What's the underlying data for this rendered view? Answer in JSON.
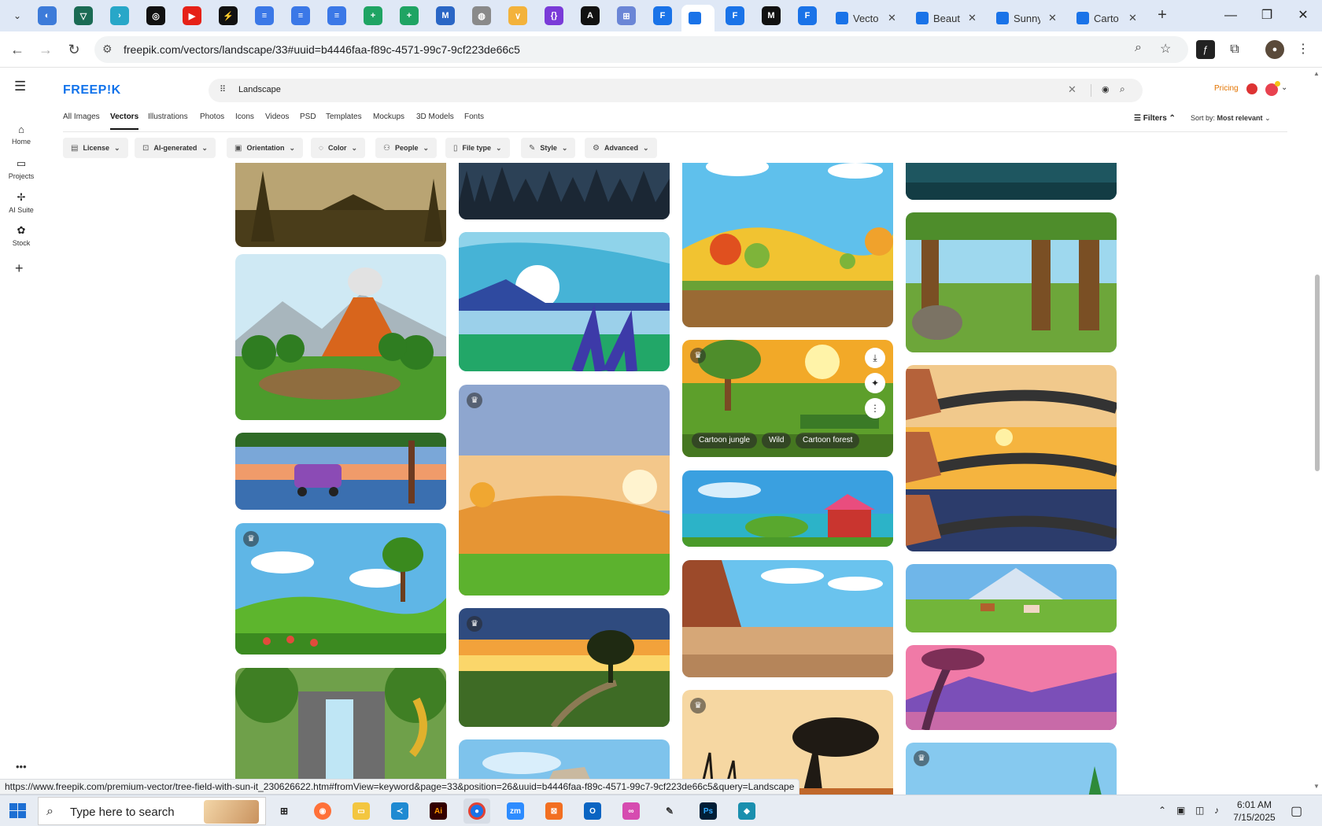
{
  "browser": {
    "tabs": [
      {
        "title": "Vecto"
      },
      {
        "title": "Beaut"
      },
      {
        "title": "Sunny"
      },
      {
        "title": "Carto"
      }
    ],
    "url": "freepik.com/vectors/landscape/33#uuid=b4446faa-f89c-4571-99c7-9cf223de66c5",
    "status_url": "https://www.freepik.com/premium-vector/tree-field-with-sun-it_230626622.htm#fromView=keyword&page=33&position=26&uuid=b4446faa-f89c-4571-99c7-9cf223de66c5&query=Landscape"
  },
  "sidebar": {
    "items": [
      {
        "label": "Home",
        "icon": "home-icon"
      },
      {
        "label": "Projects",
        "icon": "folder-icon"
      },
      {
        "label": "AI Suite",
        "icon": "sparkle-icon"
      },
      {
        "label": "Stock",
        "icon": "stock-icon"
      }
    ]
  },
  "header": {
    "logo": "FREEP!K",
    "search_value": "Landscape",
    "pricing": "Pricing"
  },
  "type_tabs": [
    {
      "label": "All Images",
      "active": false
    },
    {
      "label": "Vectors",
      "active": true
    },
    {
      "label": "Illustrations",
      "active": false
    },
    {
      "label": "Photos",
      "active": false
    },
    {
      "label": "Icons",
      "active": false
    },
    {
      "label": "Videos",
      "active": false
    },
    {
      "label": "PSD",
      "active": false
    },
    {
      "label": "Templates",
      "active": false
    },
    {
      "label": "Mockups",
      "active": false
    },
    {
      "label": "3D Models",
      "active": false
    },
    {
      "label": "Fonts",
      "active": false
    }
  ],
  "filters": {
    "toggle_label": "Filters",
    "sort_label": "Sort by:",
    "sort_value": "Most relevant",
    "chips": [
      {
        "label": "License",
        "icon": "license-icon"
      },
      {
        "label": "AI-generated",
        "icon": "ai-icon"
      },
      {
        "label": "Orientation",
        "icon": "orientation-icon"
      },
      {
        "label": "Color",
        "icon": "color-icon"
      },
      {
        "label": "People",
        "icon": "people-icon"
      },
      {
        "label": "File type",
        "icon": "file-icon"
      },
      {
        "label": "Style",
        "icon": "style-icon"
      },
      {
        "label": "Advanced",
        "icon": "advanced-icon"
      }
    ]
  },
  "hovered_card": {
    "tags": [
      "Cartoon jungle",
      "Wild",
      "Cartoon forest"
    ]
  },
  "taskbar": {
    "search_placeholder": "Type here to search",
    "time": "6:01 AM",
    "date": "7/15/2025"
  },
  "colors": {
    "brand": "#1273eb",
    "pricing": "#e37400",
    "tab_active_bg": "#ffffff",
    "tabbar_bg": "#dfe8f6"
  }
}
